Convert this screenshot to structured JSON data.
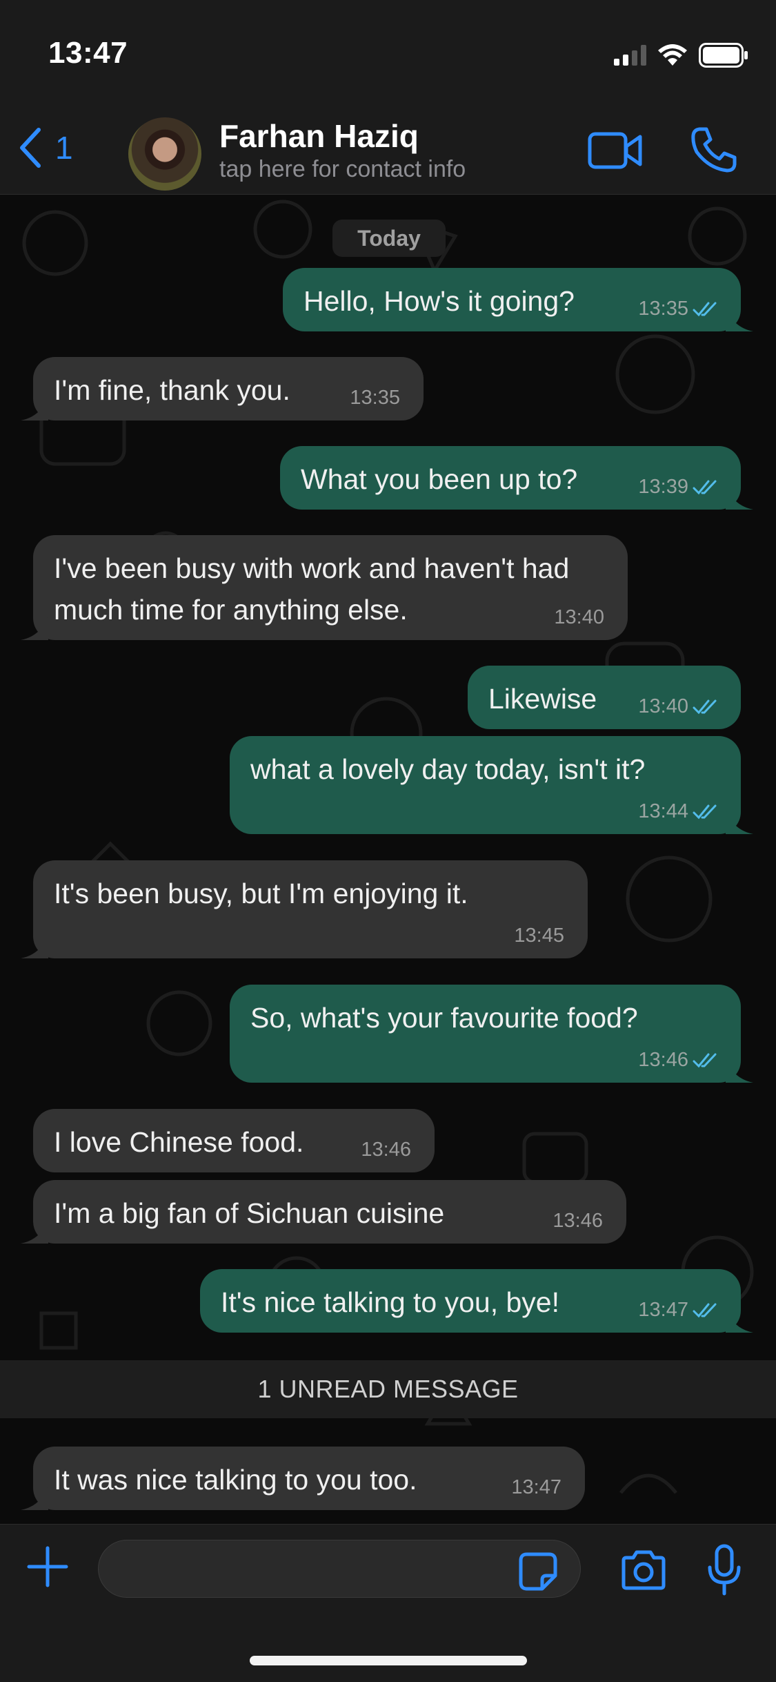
{
  "status_bar": {
    "time": "13:47",
    "signal_icon": "cellular-signal-icon",
    "wifi_icon": "wifi-icon",
    "battery_icon": "battery-icon"
  },
  "header": {
    "back_count": "1",
    "contact_name": "Farhan Haziq",
    "contact_subtitle": "tap here for contact info",
    "video_icon": "video-call-icon",
    "phone_icon": "phone-call-icon"
  },
  "chat": {
    "date_label": "Today",
    "messages": [
      {
        "direction": "out",
        "text": "Hello, How's it going?",
        "time": "13:35",
        "status": "read"
      },
      {
        "direction": "in",
        "text": "I'm fine, thank you.",
        "time": "13:35"
      },
      {
        "direction": "out",
        "text": "What you been up to?",
        "time": "13:39",
        "status": "read"
      },
      {
        "direction": "in",
        "text": "I've been busy with work and haven't had much time for anything else.",
        "time": "13:40"
      },
      {
        "direction": "out",
        "text": "Likewise",
        "time": "13:40",
        "status": "read"
      },
      {
        "direction": "out",
        "text": "what a lovely day today, isn't it?",
        "time": "13:44",
        "status": "read"
      },
      {
        "direction": "in",
        "text": "It's been busy, but I'm enjoying it.",
        "time": "13:45"
      },
      {
        "direction": "out",
        "text": "So, what's your favourite food?",
        "time": "13:46",
        "status": "read"
      },
      {
        "direction": "in",
        "text": "I love Chinese food.",
        "time": "13:46"
      },
      {
        "direction": "in",
        "text": "I'm a big fan of Sichuan cuisine",
        "time": "13:46"
      },
      {
        "direction": "out",
        "text": "It's nice talking to you, bye!",
        "time": "13:47",
        "status": "read"
      },
      {
        "direction": "in",
        "text": "It was nice talking to you too.",
        "time": "13:47"
      }
    ],
    "unread_banner": "1 UNREAD MESSAGE"
  },
  "composer": {
    "input_value": "",
    "plus_icon": "plus-icon",
    "sticker_icon": "sticker-icon",
    "camera_icon": "camera-icon",
    "mic_icon": "microphone-icon"
  },
  "colors": {
    "accent": "#2f8cff",
    "outgoing_bubble": "#1f5b4c",
    "incoming_bubble": "#333333",
    "read_ticks": "#53bdeb"
  }
}
